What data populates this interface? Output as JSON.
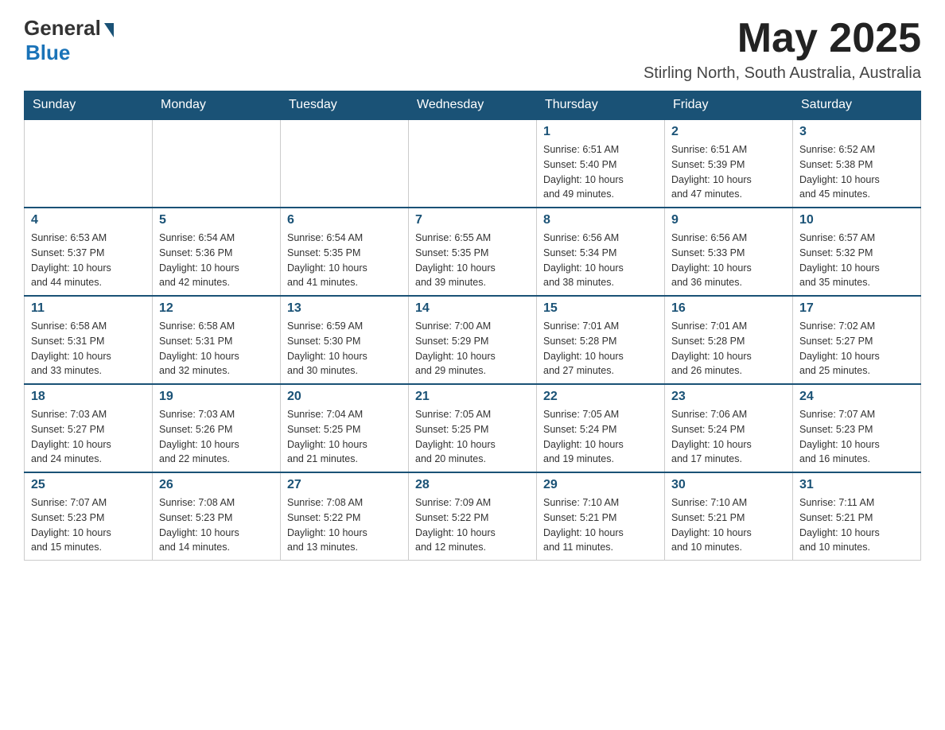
{
  "logo": {
    "general": "General",
    "blue": "Blue"
  },
  "header": {
    "month_year": "May 2025",
    "location": "Stirling North, South Australia, Australia"
  },
  "days_of_week": [
    "Sunday",
    "Monday",
    "Tuesday",
    "Wednesday",
    "Thursday",
    "Friday",
    "Saturday"
  ],
  "weeks": [
    [
      {
        "day": "",
        "info": ""
      },
      {
        "day": "",
        "info": ""
      },
      {
        "day": "",
        "info": ""
      },
      {
        "day": "",
        "info": ""
      },
      {
        "day": "1",
        "info": "Sunrise: 6:51 AM\nSunset: 5:40 PM\nDaylight: 10 hours\nand 49 minutes."
      },
      {
        "day": "2",
        "info": "Sunrise: 6:51 AM\nSunset: 5:39 PM\nDaylight: 10 hours\nand 47 minutes."
      },
      {
        "day": "3",
        "info": "Sunrise: 6:52 AM\nSunset: 5:38 PM\nDaylight: 10 hours\nand 45 minutes."
      }
    ],
    [
      {
        "day": "4",
        "info": "Sunrise: 6:53 AM\nSunset: 5:37 PM\nDaylight: 10 hours\nand 44 minutes."
      },
      {
        "day": "5",
        "info": "Sunrise: 6:54 AM\nSunset: 5:36 PM\nDaylight: 10 hours\nand 42 minutes."
      },
      {
        "day": "6",
        "info": "Sunrise: 6:54 AM\nSunset: 5:35 PM\nDaylight: 10 hours\nand 41 minutes."
      },
      {
        "day": "7",
        "info": "Sunrise: 6:55 AM\nSunset: 5:35 PM\nDaylight: 10 hours\nand 39 minutes."
      },
      {
        "day": "8",
        "info": "Sunrise: 6:56 AM\nSunset: 5:34 PM\nDaylight: 10 hours\nand 38 minutes."
      },
      {
        "day": "9",
        "info": "Sunrise: 6:56 AM\nSunset: 5:33 PM\nDaylight: 10 hours\nand 36 minutes."
      },
      {
        "day": "10",
        "info": "Sunrise: 6:57 AM\nSunset: 5:32 PM\nDaylight: 10 hours\nand 35 minutes."
      }
    ],
    [
      {
        "day": "11",
        "info": "Sunrise: 6:58 AM\nSunset: 5:31 PM\nDaylight: 10 hours\nand 33 minutes."
      },
      {
        "day": "12",
        "info": "Sunrise: 6:58 AM\nSunset: 5:31 PM\nDaylight: 10 hours\nand 32 minutes."
      },
      {
        "day": "13",
        "info": "Sunrise: 6:59 AM\nSunset: 5:30 PM\nDaylight: 10 hours\nand 30 minutes."
      },
      {
        "day": "14",
        "info": "Sunrise: 7:00 AM\nSunset: 5:29 PM\nDaylight: 10 hours\nand 29 minutes."
      },
      {
        "day": "15",
        "info": "Sunrise: 7:01 AM\nSunset: 5:28 PM\nDaylight: 10 hours\nand 27 minutes."
      },
      {
        "day": "16",
        "info": "Sunrise: 7:01 AM\nSunset: 5:28 PM\nDaylight: 10 hours\nand 26 minutes."
      },
      {
        "day": "17",
        "info": "Sunrise: 7:02 AM\nSunset: 5:27 PM\nDaylight: 10 hours\nand 25 minutes."
      }
    ],
    [
      {
        "day": "18",
        "info": "Sunrise: 7:03 AM\nSunset: 5:27 PM\nDaylight: 10 hours\nand 24 minutes."
      },
      {
        "day": "19",
        "info": "Sunrise: 7:03 AM\nSunset: 5:26 PM\nDaylight: 10 hours\nand 22 minutes."
      },
      {
        "day": "20",
        "info": "Sunrise: 7:04 AM\nSunset: 5:25 PM\nDaylight: 10 hours\nand 21 minutes."
      },
      {
        "day": "21",
        "info": "Sunrise: 7:05 AM\nSunset: 5:25 PM\nDaylight: 10 hours\nand 20 minutes."
      },
      {
        "day": "22",
        "info": "Sunrise: 7:05 AM\nSunset: 5:24 PM\nDaylight: 10 hours\nand 19 minutes."
      },
      {
        "day": "23",
        "info": "Sunrise: 7:06 AM\nSunset: 5:24 PM\nDaylight: 10 hours\nand 17 minutes."
      },
      {
        "day": "24",
        "info": "Sunrise: 7:07 AM\nSunset: 5:23 PM\nDaylight: 10 hours\nand 16 minutes."
      }
    ],
    [
      {
        "day": "25",
        "info": "Sunrise: 7:07 AM\nSunset: 5:23 PM\nDaylight: 10 hours\nand 15 minutes."
      },
      {
        "day": "26",
        "info": "Sunrise: 7:08 AM\nSunset: 5:23 PM\nDaylight: 10 hours\nand 14 minutes."
      },
      {
        "day": "27",
        "info": "Sunrise: 7:08 AM\nSunset: 5:22 PM\nDaylight: 10 hours\nand 13 minutes."
      },
      {
        "day": "28",
        "info": "Sunrise: 7:09 AM\nSunset: 5:22 PM\nDaylight: 10 hours\nand 12 minutes."
      },
      {
        "day": "29",
        "info": "Sunrise: 7:10 AM\nSunset: 5:21 PM\nDaylight: 10 hours\nand 11 minutes."
      },
      {
        "day": "30",
        "info": "Sunrise: 7:10 AM\nSunset: 5:21 PM\nDaylight: 10 hours\nand 10 minutes."
      },
      {
        "day": "31",
        "info": "Sunrise: 7:11 AM\nSunset: 5:21 PM\nDaylight: 10 hours\nand 10 minutes."
      }
    ]
  ]
}
